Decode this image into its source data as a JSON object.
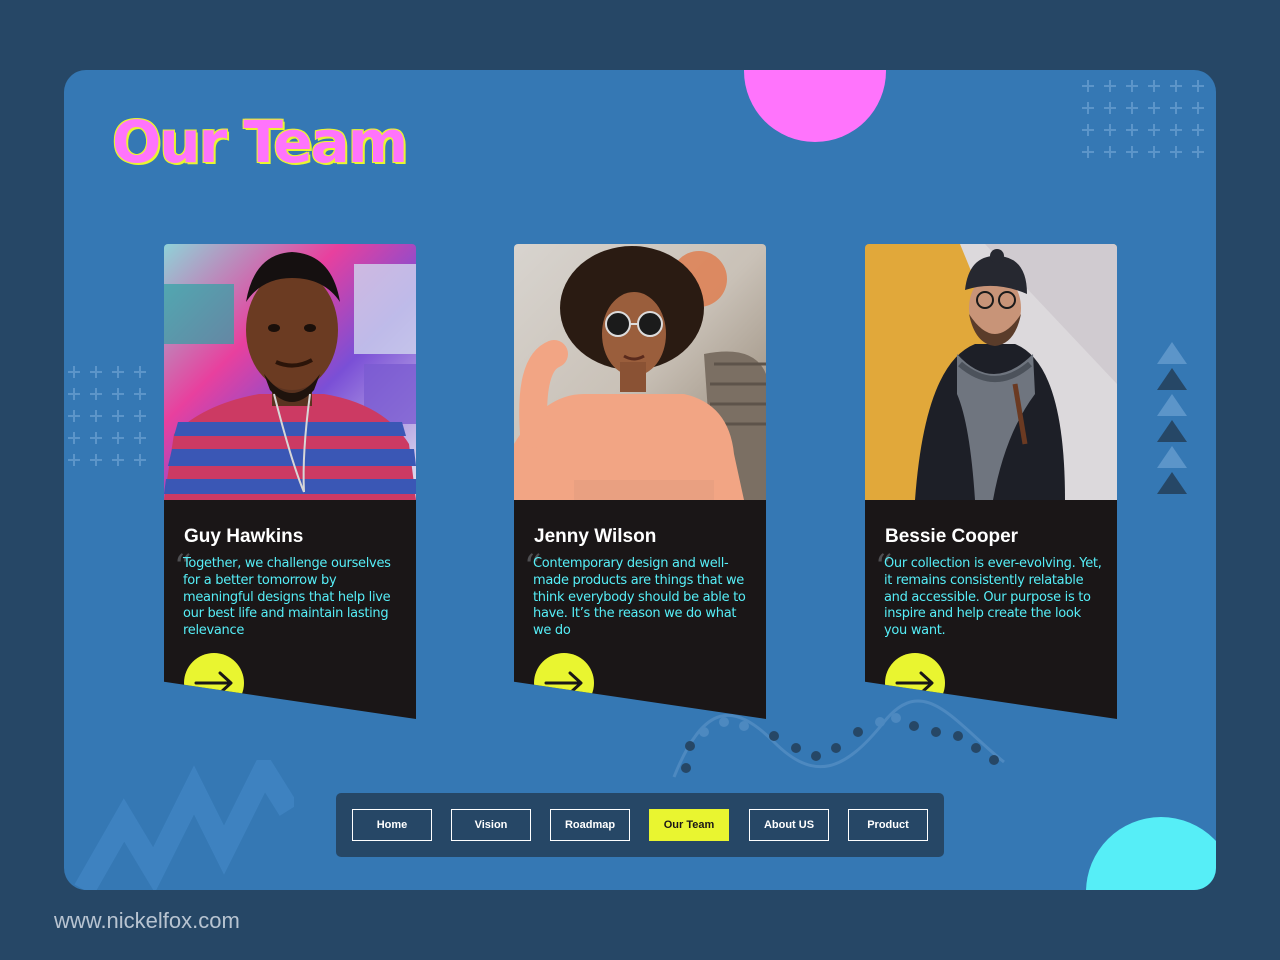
{
  "page": {
    "title": "Our Team",
    "footer_url": "www.nickelfox.com"
  },
  "team": [
    {
      "name": "Guy Hawkins",
      "quote": "Together, we challenge ourselves for a better tomorrow by meaningful designs that help live our best life and maintain lasting relevance",
      "quote_mark": "“"
    },
    {
      "name": "Jenny Wilson",
      "quote": "Contemporary design and well-made products are things that we think everybody should be able to have. It’s the reason we do what we do",
      "quote_mark": "“"
    },
    {
      "name": "Bessie Cooper",
      "quote": "Our collection is ever-evolving. Yet, it remains consistently relatable and accessible. Our purpose is to inspire and help create the look you want.",
      "quote_mark": "“"
    }
  ],
  "nav": {
    "items": [
      {
        "label": "Home",
        "active": false
      },
      {
        "label": "Vision",
        "active": false
      },
      {
        "label": "Roadmap",
        "active": false
      },
      {
        "label": "Our Team",
        "active": true
      },
      {
        "label": "About US",
        "active": false
      },
      {
        "label": "Product",
        "active": false
      }
    ]
  },
  "colors": {
    "background": "#264766",
    "slide": "#3578b4",
    "accent_yellow": "#e9f530",
    "accent_pink": "#ff74fc",
    "accent_cyan": "#56eef7",
    "card": "#1a1617"
  },
  "icons": {
    "card_button": "arrow-right-icon"
  }
}
